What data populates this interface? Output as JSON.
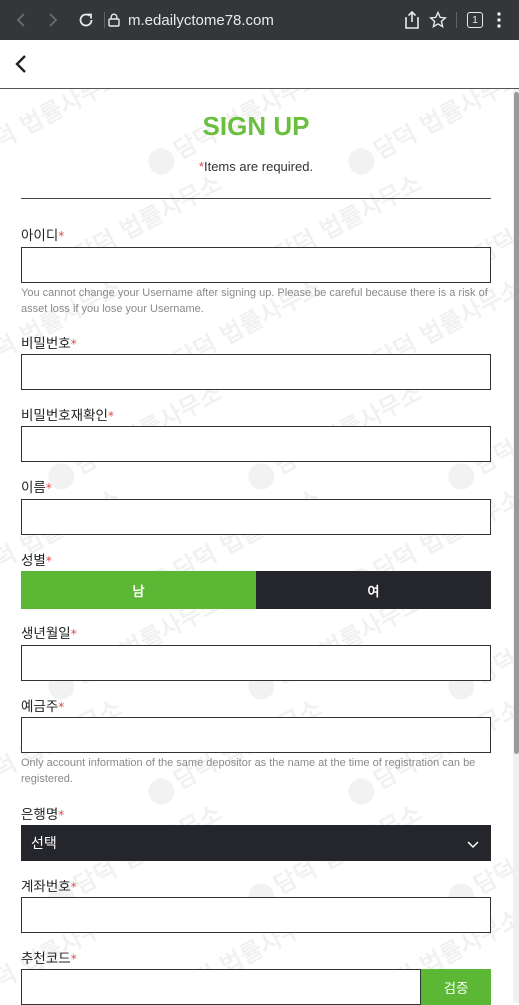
{
  "browser": {
    "url": "m.edailyctome78.com",
    "tab_count": "1"
  },
  "page": {
    "title": "SIGN UP",
    "required_star": "*",
    "required_note": "Items are required."
  },
  "form": {
    "username": {
      "label": "아이디",
      "help": "You cannot change your Username after signing up. Please be careful because there is a risk of asset loss if you lose your Username."
    },
    "password": {
      "label": "비밀번호"
    },
    "password_confirm": {
      "label": "비밀번호재확인"
    },
    "name": {
      "label": "이름"
    },
    "gender": {
      "label": "성별",
      "male": "남",
      "female": "여",
      "selected": "male"
    },
    "birthdate": {
      "label": "생년월일"
    },
    "depositor": {
      "label": "예금주",
      "help": "Only account information of the same depositor as the name at the time of registration can be registered."
    },
    "bank": {
      "label": "은행명",
      "selected": "선택"
    },
    "account": {
      "label": "계좌번호"
    },
    "referral": {
      "label": "추천코드",
      "verify_button": "검증"
    }
  },
  "watermark": {
    "text": "담덕 법률사무소"
  },
  "colors": {
    "accent": "#5cb834",
    "dark": "#25262b",
    "required": "#e04848"
  }
}
